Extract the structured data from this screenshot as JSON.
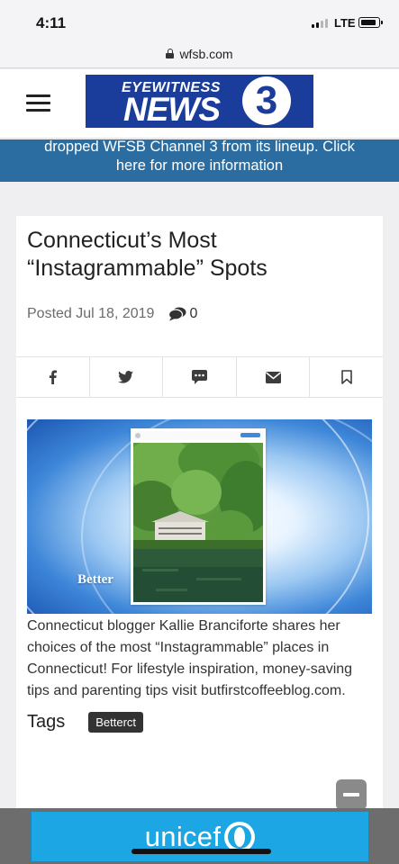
{
  "status_bar": {
    "time": "4:11",
    "network": "LTE"
  },
  "browser": {
    "url": "wfsb.com"
  },
  "site": {
    "logo_top": "EYEWITNESS",
    "logo_main": "NEWS",
    "logo_number": "3"
  },
  "alert": {
    "line1": "dropped WFSB Channel 3 from its lineup. Click",
    "line2": "here for more information"
  },
  "article": {
    "title": "Connecticut’s Most “Instagrammable” Spots",
    "posted": "Posted Jul 18, 2019",
    "comment_count": "0",
    "share_buttons": [
      "facebook-icon",
      "twitter-icon",
      "sms-icon",
      "email-icon",
      "bookmark-icon"
    ],
    "image_brand": "Better",
    "body": "Connecticut blogger Kallie Branciforte shares her choices of the most “Instagrammable” places in Connecticut! For lifestyle inspiration, money-saving tips and parenting tips visit butfirstcoffeeblog.com.",
    "tags_label": "Tags",
    "tags": [
      "Betterct"
    ]
  },
  "ad": {
    "brand": "unicef"
  },
  "colors": {
    "alert_bg": "#2b6da0",
    "logo_bg": "#1a3c9b",
    "unicef_blue": "#1ca6e3"
  }
}
